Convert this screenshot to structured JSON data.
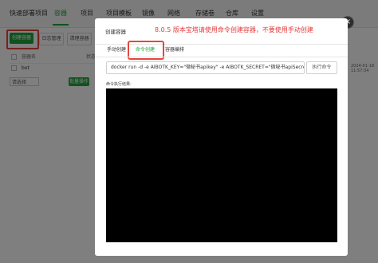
{
  "nav": {
    "items": [
      "快速部署项目",
      "容器",
      "项目",
      "项目模板",
      "镜像",
      "网络",
      "存储卷",
      "仓库",
      "设置"
    ],
    "active_index": 1,
    "accent": "#20a53a"
  },
  "toolbar": {
    "create_label": "创建容器",
    "log_label": "日志管理",
    "clean_label": "清理容器"
  },
  "table": {
    "header_name": "容器名",
    "header_status": "状态",
    "row_name": "bot",
    "select_value": "请选择",
    "batch_label": "批量操作",
    "right_text": "2024-01-18 11:57:34"
  },
  "dialog": {
    "title": "创建容器",
    "annotation": "8.0.5 版本宝塔请使用命令创建容器，不要使用手动创建",
    "annotation_color": "#e4393c",
    "close_icon": "×",
    "tabs": [
      "手动创建",
      "命令创建",
      "容器编排"
    ],
    "active_tab": 1,
    "command_value": "docker run -d -e AIBOTK_KEY=\"微秘书apikey\" -e AIBOTK_SECRET=\"微秘书apiSecret\"",
    "exec_label": "执行命令",
    "result_label": "命令执行结果:"
  }
}
